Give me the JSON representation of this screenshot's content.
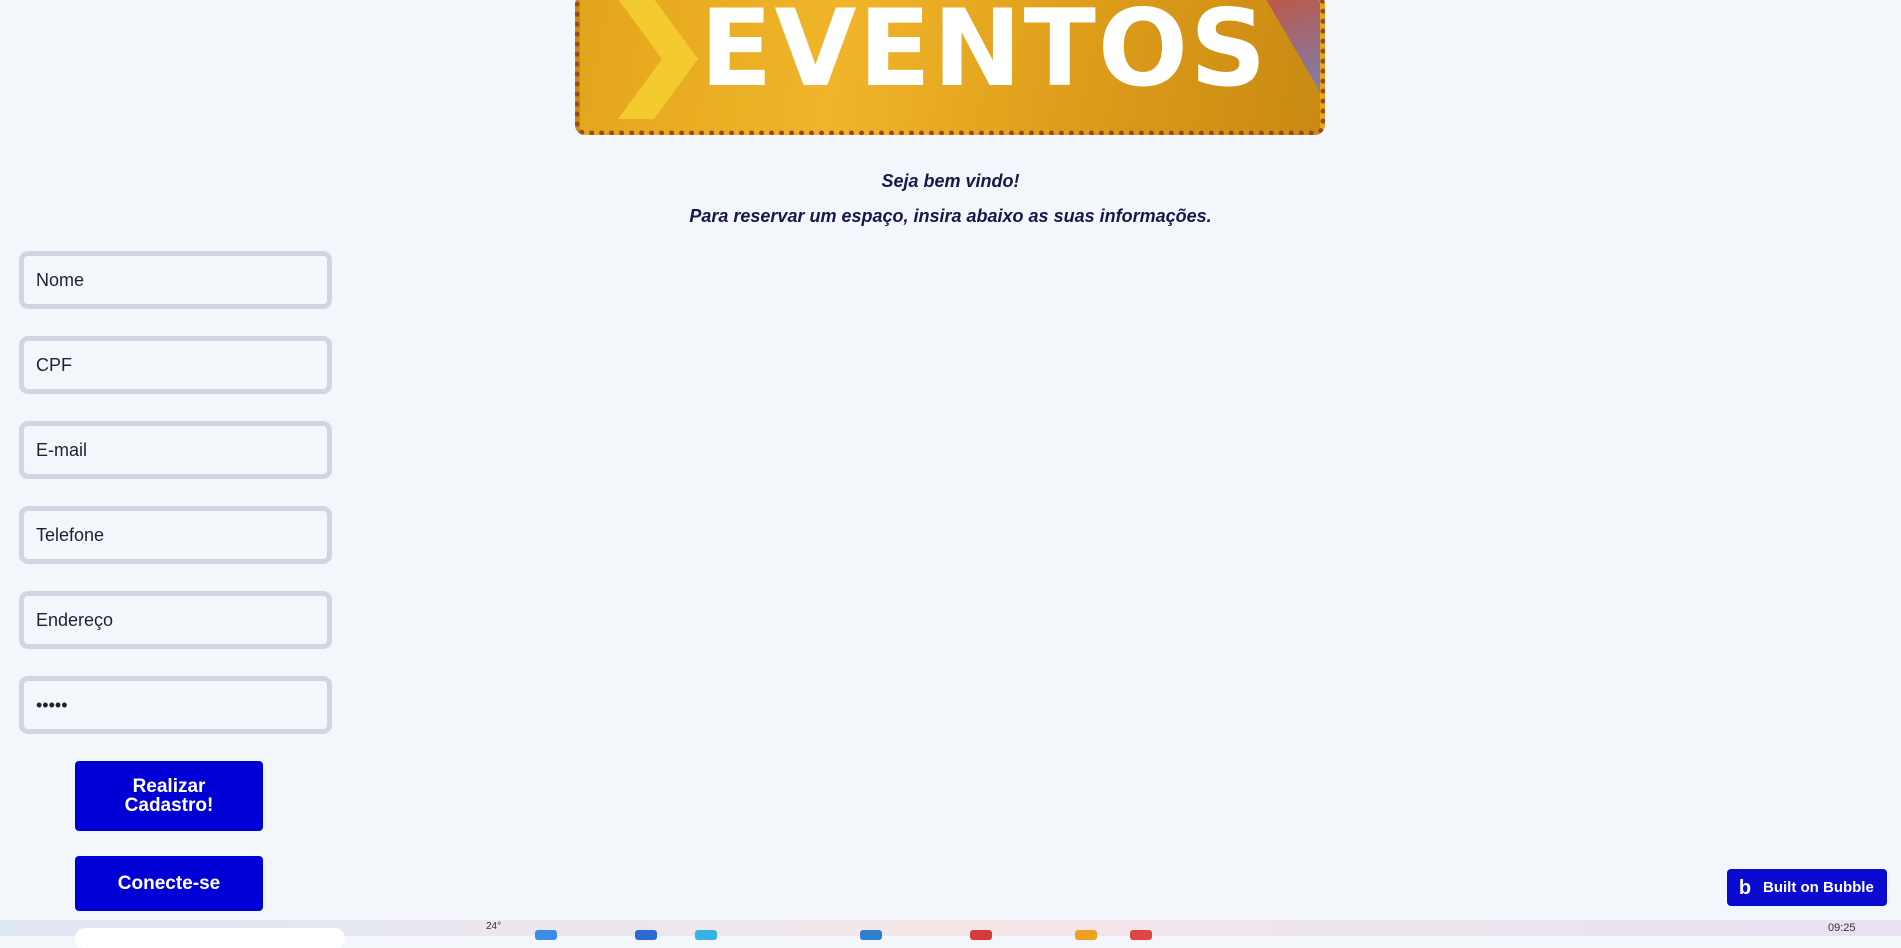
{
  "banner": {
    "word": "EVENTOS"
  },
  "welcome": {
    "line1": "Seja bem vindo!",
    "line2": "Para reservar um espaço, insira abaixo as suas informações."
  },
  "form": {
    "nome": "Nome",
    "cpf": "CPF",
    "email": "E-mail",
    "telefone": "Telefone",
    "endereco": "Endereço",
    "senha": "•••••"
  },
  "buttons": {
    "register": "Realizar Cadastro!",
    "login": "Conecte-se"
  },
  "badge": {
    "label": "Built on Bubble",
    "logo": "b"
  },
  "taskbar": {
    "temp": "24°",
    "time": "09:25"
  },
  "colors": {
    "accent": "#0000d6",
    "background": "#f3f7fb",
    "field_border": "#d1d5e2"
  }
}
